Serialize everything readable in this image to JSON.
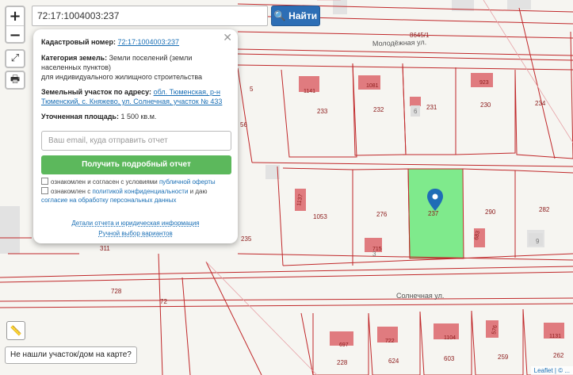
{
  "search": {
    "value": "72:17:1004003:237",
    "button_label": "Найти"
  },
  "controls": {
    "zoom_in": "+",
    "zoom_out": "−"
  },
  "popup": {
    "cadastral_label": "Кадастровый номер:",
    "cadastral_value": "72:17:1004003:237",
    "category_label": "Категория земель:",
    "category_value": "Земли поселений (земли населенных пунктов)",
    "category_extra": "для индивидуального жилищного строительства",
    "address_label": "Земельный участок по адресу:",
    "address_value": "обл. Тюменская, р-н Тюменский, с. Княжево, ул. Солнечная, участок № 433",
    "area_label": "Уточненная площадь:",
    "area_value": "1 500 кв.м.",
    "email_placeholder": "Ваш email, куда отправить отчет",
    "submit_label": "Получить подробный отчет",
    "consent1_text": "ознакомлен и согласен с условиями",
    "consent1_link": "публичной оферты",
    "consent2_text": "ознакомлен с",
    "consent2_link": "политикой конфиденциальности",
    "consent2_text2": "и даю",
    "consent2_link2": "согласие на обработку персональных данных",
    "details_link": "Детали отчета и юридическая информация",
    "manual_link": "Ручной выбор вариантов"
  },
  "not_found_label": "Не нашли участок/дом на карте?",
  "attribution": {
    "leaflet": "Leaflet",
    "sep": " | ",
    "rest": "© ..."
  },
  "map": {
    "streets": [
      "Молодёжная ул.",
      "Солнечная ул."
    ],
    "parcels": [
      "8645/1",
      "233",
      "232",
      "231",
      "230",
      "234",
      "56",
      "1053",
      "276",
      "237",
      "290",
      "282",
      "235",
      "311",
      "728",
      "72",
      "228",
      "624",
      "603",
      "259",
      "262",
      "6",
      "3",
      "9"
    ],
    "houses": [
      "1141",
      "1081",
      "923",
      "1137",
      "715",
      "683",
      "697",
      "722",
      "1104",
      "576",
      "1131"
    ],
    "colors": {
      "selected": "#7fea8c",
      "boundary": "#c0282a",
      "house": "#e07b7f"
    }
  }
}
